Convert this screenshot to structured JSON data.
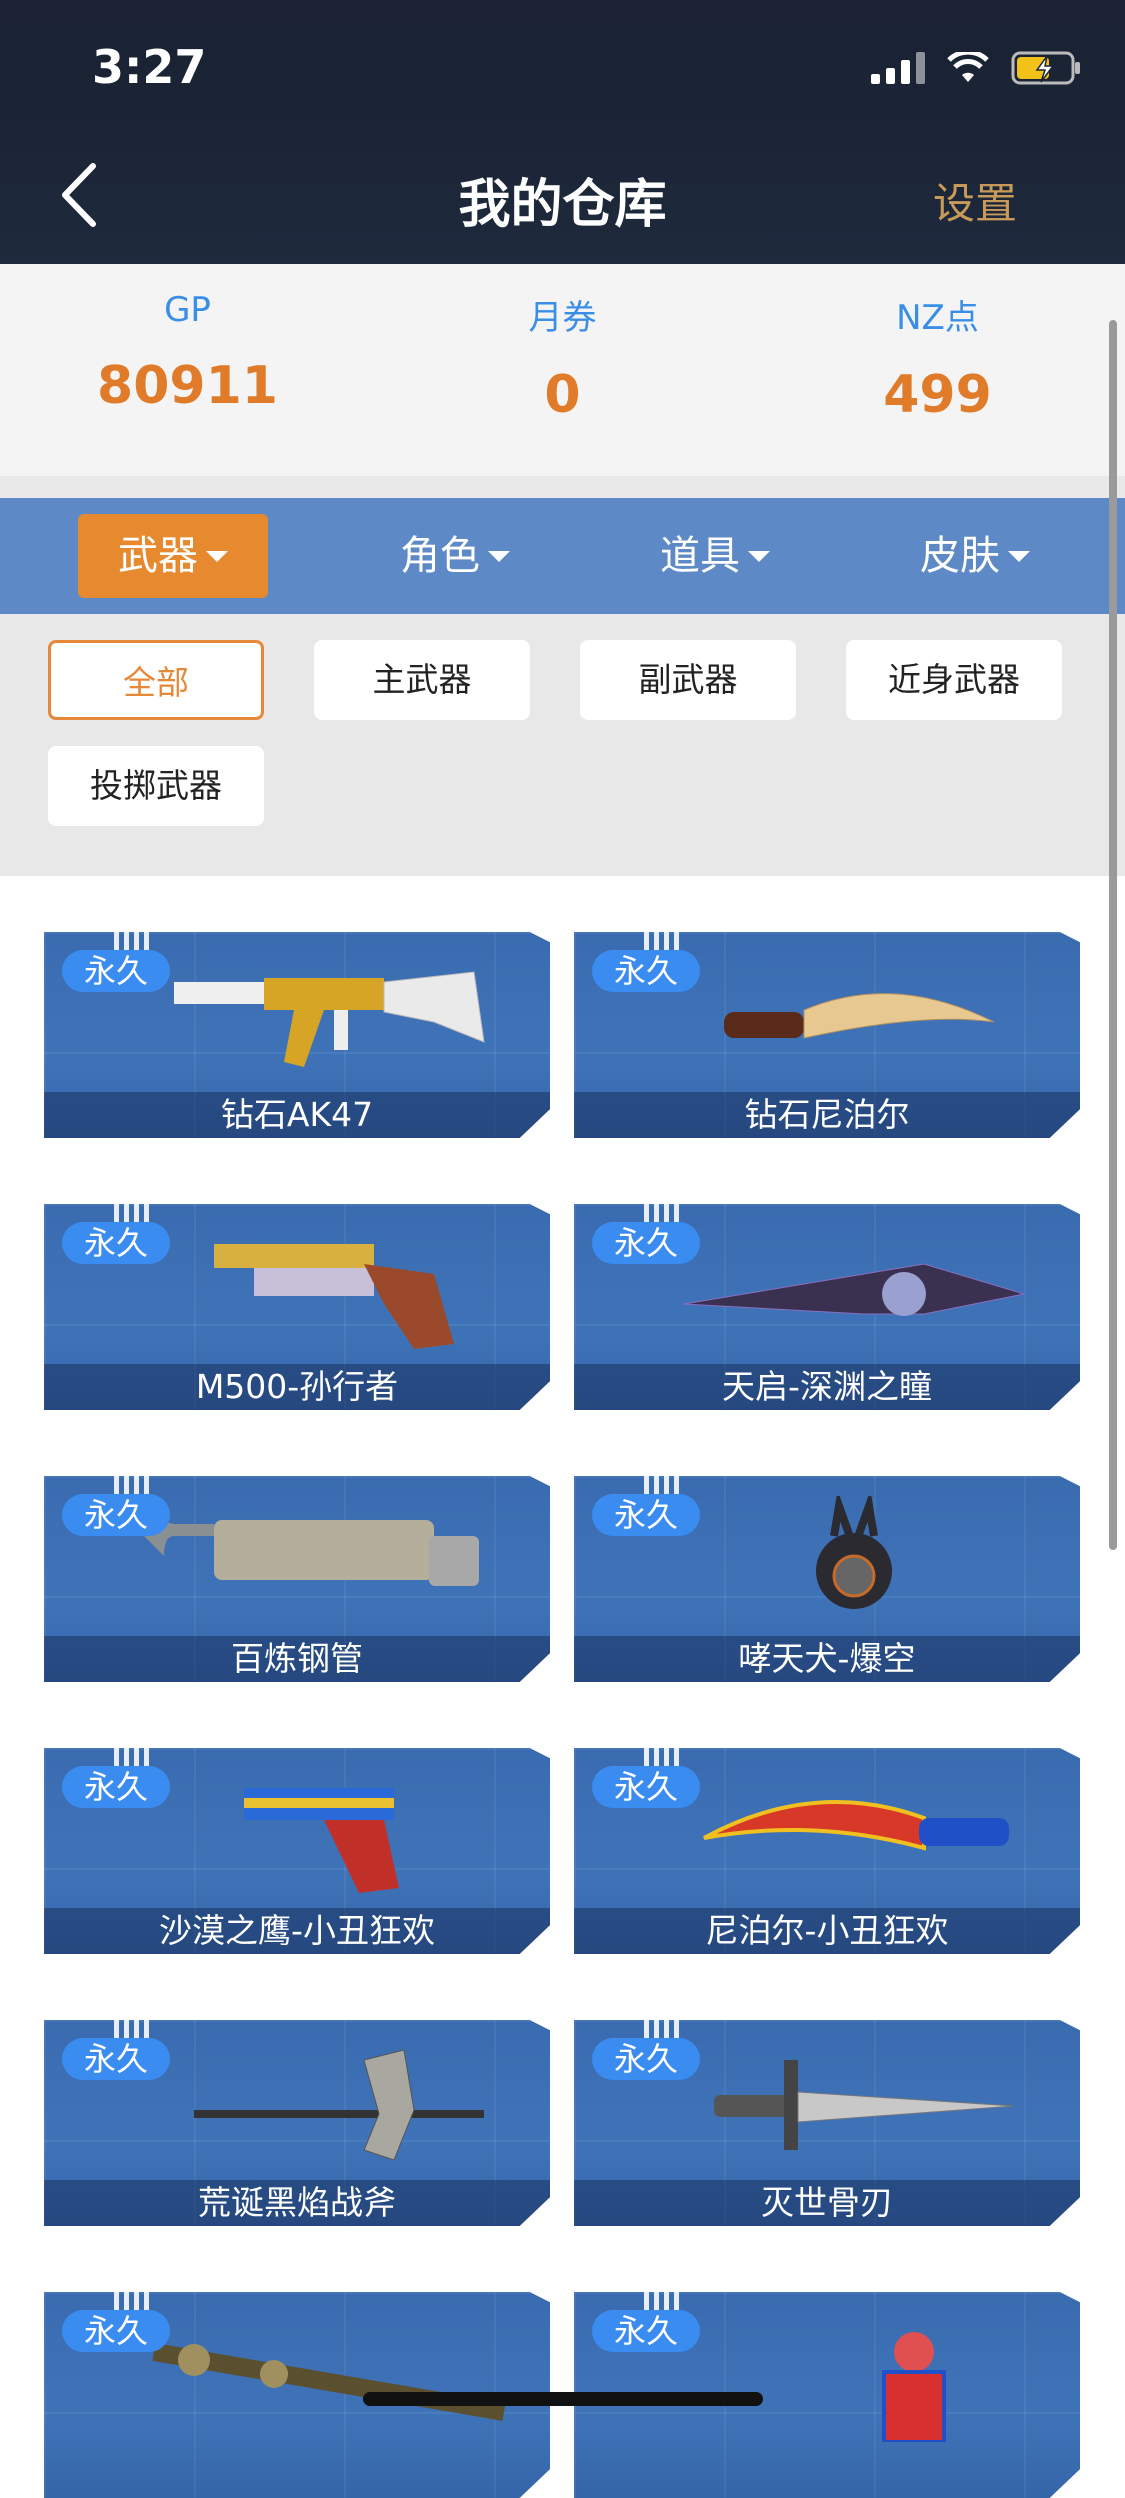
{
  "status_bar": {
    "time": "3:27"
  },
  "header": {
    "title": "我的仓库",
    "settings_label": "设置"
  },
  "stats": [
    {
      "label": "GP",
      "value": "80911"
    },
    {
      "label": "月券",
      "value": "0"
    },
    {
      "label": "NZ点",
      "value": "499"
    }
  ],
  "categories": [
    {
      "label": "武器",
      "active": true
    },
    {
      "label": "角色",
      "active": false
    },
    {
      "label": "道具",
      "active": false
    },
    {
      "label": "皮肤",
      "active": false
    }
  ],
  "subfilters": [
    {
      "label": "全部",
      "active": true
    },
    {
      "label": "主武器",
      "active": false
    },
    {
      "label": "副武器",
      "active": false
    },
    {
      "label": "近身武器",
      "active": false
    },
    {
      "label": "投掷武器",
      "active": false
    }
  ],
  "items": [
    {
      "badge": "永久",
      "name": "钻石AK47",
      "icon": "rifle-icon"
    },
    {
      "badge": "永久",
      "name": "钻石尼泊尔",
      "icon": "kukri-knife-icon"
    },
    {
      "badge": "永久",
      "name": "M500-孙行者",
      "icon": "revolver-icon"
    },
    {
      "badge": "永久",
      "name": "天启-深渊之瞳",
      "icon": "dark-blade-icon"
    },
    {
      "badge": "永久",
      "name": "百炼钢管",
      "icon": "steel-pipe-icon"
    },
    {
      "badge": "永久",
      "name": "哮天犬-爆空",
      "icon": "dog-grenade-icon"
    },
    {
      "badge": "永久",
      "name": "沙漠之鹰-小丑狂欢",
      "icon": "pistol-icon"
    },
    {
      "badge": "永久",
      "name": "尼泊尔-小丑狂欢",
      "icon": "kukri-knife-icon"
    },
    {
      "badge": "永久",
      "name": "荒诞黑焰战斧",
      "icon": "axe-icon"
    },
    {
      "badge": "永久",
      "name": "灭世骨刃",
      "icon": "sword-icon"
    },
    {
      "badge": "永久",
      "name": "",
      "icon": "ornate-staff-icon"
    },
    {
      "badge": "永久",
      "name": "",
      "icon": "jack-in-box-icon"
    }
  ],
  "colors": {
    "accent_orange": "#e7892e",
    "stat_label_blue": "#3a8ee6",
    "category_bar": "#5d8ac6",
    "card_blue": "#3f73b8"
  }
}
